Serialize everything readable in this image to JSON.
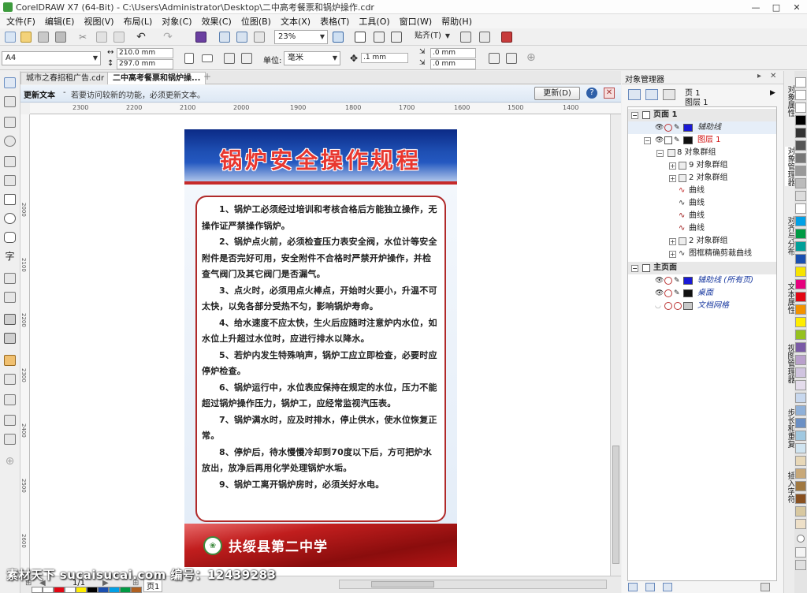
{
  "window": {
    "title": "CorelDRAW X7 (64-Bit) - C:\\Users\\Administrator\\Desktop\\二中高考餐票和锅炉操作.cdr",
    "buttons": [
      "—",
      "□",
      "✕"
    ]
  },
  "menu": [
    "文件(F)",
    "编辑(E)",
    "视图(V)",
    "布局(L)",
    "对象(C)",
    "效果(C)",
    "位图(B)",
    "文本(X)",
    "表格(T)",
    "工具(O)",
    "窗口(W)",
    "帮助(H)"
  ],
  "toolbar": {
    "zoom": "23%",
    "snap": "贴齐(T)"
  },
  "property_bar": {
    "page_size": "A4",
    "width": "210.0 mm",
    "height": "297.0 mm",
    "unit_label": "单位:",
    "unit": "毫米",
    "nudge": ".1 mm",
    "dup_x": ".0 mm",
    "dup_y": ".0 mm"
  },
  "doc_tabs": [
    {
      "label": "城市之春招租广告.cdr"
    },
    {
      "label": "二中高考餐票和锅炉操..."
    }
  ],
  "hint": {
    "title": "更新文本",
    "message": "若要访问较新的功能，必须更新文本。",
    "button": "更新(D)"
  },
  "ruler": {
    "h": [
      "2300",
      "2200",
      "2100",
      "2000",
      "1900",
      "1800",
      "1700",
      "1600",
      "1500",
      "1400"
    ],
    "v": [
      "2000",
      "2100",
      "2200",
      "2300",
      "2400",
      "2500",
      "2600",
      "2700"
    ]
  },
  "poster": {
    "title": "锅炉安全操作规程",
    "rules": [
      "1、锅炉工必须经过培训和考核合格后方能独立操作，无操作证严禁操作锅炉。",
      "2、锅炉点火前，必须检查压力表安全阀，水位计等安全附件是否完好可用，安全附件不合格时严禁开炉操作，并检查气阀门及其它阀门是否漏气。",
      "3、点火时，必须用点火棒点，开始时火要小，升温不可太快，以免各部分受热不匀，影响锅炉寿命。",
      "4、给水速度不应太快，生火后应随时注意炉内水位，如水位上升超过水位时，应进行排水以降水。",
      "5、若炉内发生特殊响声，锅炉工应立即检查，必要时应停炉检查。",
      "6、锅炉运行中，水位表应保持在规定的水位，压力不能超过锅炉操作压力，锅炉工，应经常监视汽压表。",
      "7、锅炉满水时，应及时排水，停止供水，使水位恢复正常。",
      "8、停炉后，待水慢慢冷却到70度以下后，方可把炉水放出，放净后再用化学处理锅炉水垢。",
      "9、锅炉工离开锅炉房时，必须关好水电。"
    ],
    "school": "扶绥县第二中学"
  },
  "object_manager": {
    "title": "对象管理器",
    "page_label": "页 1",
    "layer_label": "图层 1",
    "rows": [
      {
        "text": "页面 1"
      },
      {
        "text": "辅助线"
      },
      {
        "text": "图层 1"
      },
      {
        "text": "8 对象群组"
      },
      {
        "text": "9 对象群组"
      },
      {
        "text": "2 对象群组"
      },
      {
        "text": "曲线"
      },
      {
        "text": "曲线"
      },
      {
        "text": "曲线"
      },
      {
        "text": "曲线"
      },
      {
        "text": "2 对象群组"
      },
      {
        "text": "图框精确剪裁曲线"
      },
      {
        "text": "主页面"
      },
      {
        "text": "辅助线 (所有页)"
      },
      {
        "text": "桌面"
      },
      {
        "text": "文档网格"
      }
    ]
  },
  "side_tabs": [
    "对象属性",
    "对象管理器",
    "对齐与分布",
    "文本属性",
    "视图管理器",
    "步长和重复",
    "插入字符"
  ],
  "status": {
    "page_counter": "1/1",
    "page_tab": "页1"
  },
  "watermark": "素材天下 sucaisucai.com  编号：12439283",
  "colors": {
    "accent": "#1e4fb3",
    "title_red": "#e8372f",
    "frame_red": "#b02a2a"
  }
}
